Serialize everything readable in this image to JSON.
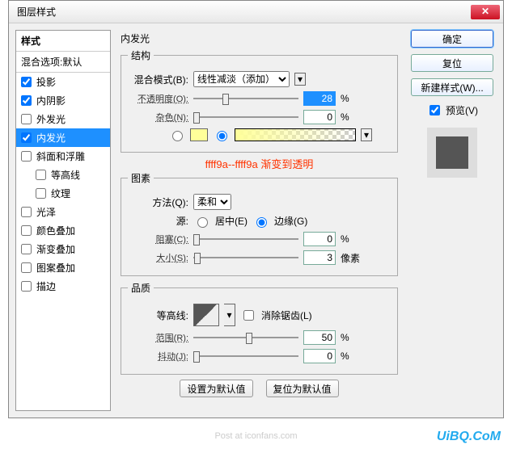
{
  "title": "图层样式",
  "sidebar": {
    "header": "样式",
    "blend": "混合选项:默认",
    "items": [
      {
        "label": "投影",
        "checked": true,
        "indent": false
      },
      {
        "label": "内阴影",
        "checked": true,
        "indent": false
      },
      {
        "label": "外发光",
        "checked": false,
        "indent": false
      },
      {
        "label": "内发光",
        "checked": true,
        "indent": false,
        "selected": true
      },
      {
        "label": "斜面和浮雕",
        "checked": false,
        "indent": false
      },
      {
        "label": "等高线",
        "checked": false,
        "indent": true
      },
      {
        "label": "纹理",
        "checked": false,
        "indent": true
      },
      {
        "label": "光泽",
        "checked": false,
        "indent": false
      },
      {
        "label": "颜色叠加",
        "checked": false,
        "indent": false
      },
      {
        "label": "渐变叠加",
        "checked": false,
        "indent": false
      },
      {
        "label": "图案叠加",
        "checked": false,
        "indent": false
      },
      {
        "label": "描边",
        "checked": false,
        "indent": false
      }
    ]
  },
  "main": {
    "title": "内发光",
    "structure": {
      "legend": "结构",
      "blend_label": "混合模式(B):",
      "blend_value": "线性减淡（添加）",
      "opacity_label": "不透明度(O):",
      "opacity_value": "28",
      "opacity_unit": "%",
      "noise_label": "杂色(N):",
      "noise_value": "0",
      "noise_unit": "%",
      "swatch_color": "#ffff9a",
      "annotation": "ffff9a--ffff9a 渐变到透明"
    },
    "elements": {
      "legend": "图素",
      "method_label": "方法(Q):",
      "method_value": "柔和",
      "source_label": "源:",
      "source_center": "居中(E)",
      "source_edge": "边缘(G)",
      "choke_label": "阻塞(C):",
      "choke_value": "0",
      "choke_unit": "%",
      "size_label": "大小(S):",
      "size_value": "3",
      "size_unit": "像素"
    },
    "quality": {
      "legend": "品质",
      "contour_label": "等高线:",
      "antialias": "消除锯齿(L)",
      "range_label": "范围(R):",
      "range_value": "50",
      "range_unit": "%",
      "jitter_label": "抖动(J):",
      "jitter_value": "0",
      "jitter_unit": "%"
    },
    "bottom": {
      "set_default": "设置为默认值",
      "reset_default": "复位为默认值"
    }
  },
  "right": {
    "ok": "确定",
    "cancel": "复位",
    "newstyle": "新建样式(W)...",
    "preview": "预览(V)"
  },
  "watermark": "UiBQ.CoM",
  "footer": "Post at iconfans.com"
}
